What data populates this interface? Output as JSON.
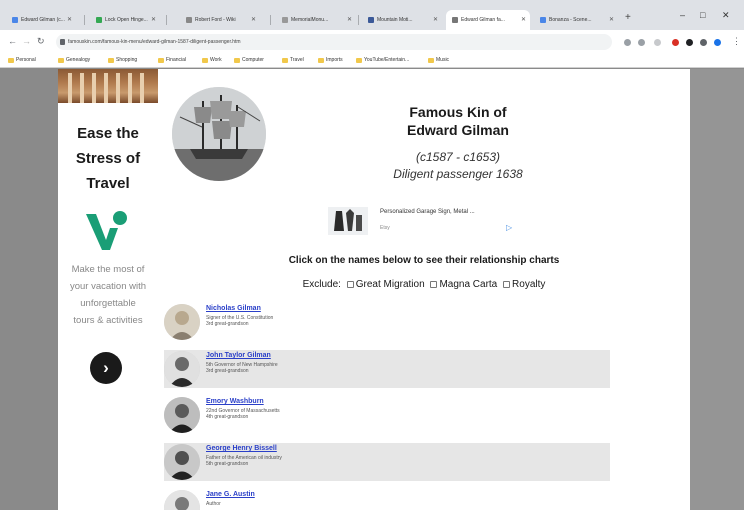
{
  "browser": {
    "tabs": [
      {
        "label": "Edward Gilman (c...",
        "favicon_color": "#4a86e8",
        "active": false
      },
      {
        "label": "Lock Open Hinge...",
        "favicon_color": "#34a853",
        "active": false
      },
      {
        "label": "Robert Ford - Wiki",
        "favicon_color": "#888888",
        "active": false
      },
      {
        "label": "MemorialMonu...",
        "favicon_color": "#999999",
        "active": false
      },
      {
        "label": "Mountain Moti...",
        "favicon_color": "#3b5998",
        "active": false
      },
      {
        "label": "Edward Gilman fa...",
        "favicon_color": "#777777",
        "active": true
      },
      {
        "label": "Bonanza - Scene...",
        "favicon_color": "#4a86e8",
        "active": false
      }
    ],
    "new_tab_glyph": "+",
    "window_controls": [
      "–",
      "□",
      "✕"
    ],
    "url": "famouskin.com/famous-kin-menu/edward-gilman-1587-diligent-passenger.htm",
    "bookmarks": [
      "Personal",
      "Genealogy",
      "Shopping",
      "Financial",
      "Work",
      "Computer",
      "Travel",
      "Imports",
      "YouTube/Entertain...",
      "Music"
    ]
  },
  "ad": {
    "title_lines": [
      "Ease the",
      "Stress of",
      "Travel"
    ],
    "body_lines": [
      "Make the most of",
      "your vacation with",
      "unforgettable",
      "tours & activities"
    ],
    "cta_glyph": "›",
    "brand_color": "#1a9e76"
  },
  "page": {
    "title_lines": [
      "Famous Kin of",
      "Edward Gilman"
    ],
    "dates_lines": [
      "(c1587 - c1653)",
      "Diligent passenger 1638"
    ],
    "product": {
      "name": "Personalized Garage Sign, Metal ...",
      "store": "Etsy",
      "info_glyph": "▷"
    },
    "instruction": "Click on the names below to see their relationship charts",
    "exclude_label": "Exclude:",
    "exclude_options": [
      "Great Migration",
      "Magna Carta",
      "Royalty"
    ],
    "kin": [
      {
        "name": "Nicholas Gilman",
        "line1": "Signer of the U.S. Constitution",
        "line2": "3rd great-grandson"
      },
      {
        "name": "John Taylor Gilman",
        "line1": "5th Governor of New Hampshire",
        "line2": "3rd great-grandson"
      },
      {
        "name": "Emory Washburn",
        "line1": "22nd Governor of Massachusetts",
        "line2": "4th great-grandson"
      },
      {
        "name": "George Henry Bissell",
        "line1": "Father of the American oil industry",
        "line2": "5th great-grandson"
      },
      {
        "name": "Jane G. Austin",
        "line1": "Author",
        "line2": ""
      }
    ]
  }
}
